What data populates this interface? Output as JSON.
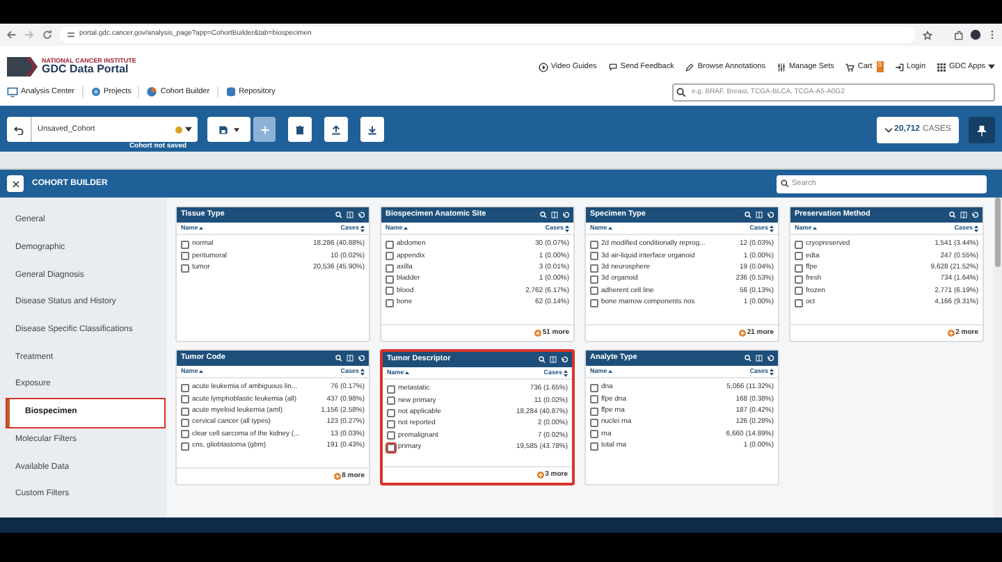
{
  "browser": {
    "url": "portal.gdc.cancer.gov/analysis_page?app=CohortBuilder&tab=biospecimen"
  },
  "header": {
    "org": "NATIONAL CANCER INSTITUTE",
    "title": "GDC Data Portal",
    "links": [
      {
        "kind": "video",
        "label": "Video Guides"
      },
      {
        "kind": "feedback",
        "label": "Send Feedback"
      },
      {
        "kind": "annotations",
        "label": "Browse Annotations"
      },
      {
        "kind": "sets",
        "label": "Manage Sets"
      },
      {
        "kind": "cart",
        "label": "Cart",
        "badge": "0"
      },
      {
        "kind": "login",
        "label": "Login"
      },
      {
        "kind": "apps",
        "label": "GDC Apps"
      }
    ],
    "nav": [
      {
        "kind": "analysis",
        "label": "Analysis Center"
      },
      {
        "kind": "projects",
        "label": "Projects"
      },
      {
        "kind": "cohort",
        "label": "Cohort Builder"
      },
      {
        "kind": "repository",
        "label": "Repository"
      }
    ],
    "search": {
      "placeholder": "e.g. BRAF, Breast, TCGA-BLCA, TCGA-A5-A0G2"
    }
  },
  "cohort_bar": {
    "name": "Unsaved_Cohort",
    "status": "Cohort not saved",
    "cases_count": "20,712",
    "cases_label": "CASES"
  },
  "cohort_builder": {
    "title": "COHORT BUILDER",
    "search": {
      "placeholder": "Search"
    },
    "sidebar": [
      {
        "label": "General",
        "selected": false,
        "highlighted": false
      },
      {
        "label": "Demographic",
        "selected": false,
        "highlighted": false
      },
      {
        "label": "General Diagnosis",
        "selected": false,
        "highlighted": false
      },
      {
        "label": "Disease Status and History",
        "selected": false,
        "highlighted": false
      },
      {
        "label": "Disease Specific Classifications",
        "selected": false,
        "highlighted": false
      },
      {
        "label": "Treatment",
        "selected": false,
        "highlighted": false
      },
      {
        "label": "Exposure",
        "selected": false,
        "highlighted": false
      },
      {
        "label": "Biospecimen",
        "selected": true,
        "highlighted": true
      },
      {
        "label": "Molecular Filters",
        "selected": false,
        "highlighted": false
      },
      {
        "label": "Available Data",
        "selected": false,
        "highlighted": false
      },
      {
        "label": "Custom Filters",
        "selected": false,
        "highlighted": false
      }
    ],
    "cards": [
      {
        "title": "Tissue Type",
        "name_header": "Name",
        "cases_header": "Cases",
        "highlighted": false,
        "rows": [
          {
            "name": "normal",
            "cases": "18,286 (40.88%)",
            "checked": false,
            "highlighted": false
          },
          {
            "name": "peritumoral",
            "cases": "10 (0.02%)",
            "checked": false,
            "highlighted": false
          },
          {
            "name": "tumor",
            "cases": "20,536 (45.90%)",
            "checked": false,
            "highlighted": false
          }
        ]
      },
      {
        "title": "Biospecimen Anatomic Site",
        "name_header": "Name",
        "cases_header": "Cases",
        "highlighted": false,
        "more": "51 more",
        "rows": [
          {
            "name": "abdomen",
            "cases": "30 (0.07%)",
            "checked": false,
            "highlighted": false
          },
          {
            "name": "appendix",
            "cases": "1 (0.00%)",
            "checked": false,
            "highlighted": false
          },
          {
            "name": "axilla",
            "cases": "3 (0.01%)",
            "checked": false,
            "highlighted": false
          },
          {
            "name": "bladder",
            "cases": "1 (0.00%)",
            "checked": false,
            "highlighted": false
          },
          {
            "name": "blood",
            "cases": "2,762 (6.17%)",
            "checked": false,
            "highlighted": false
          },
          {
            "name": "bone",
            "cases": "62 (0.14%)",
            "checked": false,
            "highlighted": false
          }
        ]
      },
      {
        "title": "Specimen Type",
        "name_header": "Name",
        "cases_header": "Cases",
        "highlighted": false,
        "more": "21 more",
        "rows": [
          {
            "name": "2d modified conditionally reprog...",
            "cases": "12 (0.03%)",
            "checked": false,
            "highlighted": false
          },
          {
            "name": "3d air-liquid interface organoid",
            "cases": "1 (0.00%)",
            "checked": false,
            "highlighted": false
          },
          {
            "name": "3d neurosphere",
            "cases": "19 (0.04%)",
            "checked": false,
            "highlighted": false
          },
          {
            "name": "3d organoid",
            "cases": "236 (0.53%)",
            "checked": false,
            "highlighted": false
          },
          {
            "name": "adherent cell line",
            "cases": "56 (0.13%)",
            "checked": false,
            "highlighted": false
          },
          {
            "name": "bone marrow components nos",
            "cases": "1 (0.00%)",
            "checked": false,
            "highlighted": false
          }
        ]
      },
      {
        "title": "Preservation Method",
        "name_header": "Name",
        "cases_header": "Cases",
        "highlighted": false,
        "more": "2 more",
        "rows": [
          {
            "name": "cryopreserved",
            "cases": "1,541 (3.44%)",
            "checked": false,
            "highlighted": false
          },
          {
            "name": "edta",
            "cases": "247 (0.55%)",
            "checked": false,
            "highlighted": false
          },
          {
            "name": "ffpe",
            "cases": "9,628 (21.52%)",
            "checked": false,
            "highlighted": false
          },
          {
            "name": "fresh",
            "cases": "734 (1.64%)",
            "checked": false,
            "highlighted": false
          },
          {
            "name": "frozen",
            "cases": "2,771 (6.19%)",
            "checked": false,
            "highlighted": false
          },
          {
            "name": "oct",
            "cases": "4,166 (9.31%)",
            "checked": false,
            "highlighted": false
          }
        ]
      },
      {
        "title": "Tumor Code",
        "name_header": "Name",
        "cases_header": "Cases",
        "highlighted": false,
        "more": "8 more",
        "rows": [
          {
            "name": "acute leukemia of ambiguous lin...",
            "cases": "76 (0.17%)",
            "checked": false,
            "highlighted": false
          },
          {
            "name": "acute lymphoblastic leukemia (all)",
            "cases": "437 (0.98%)",
            "checked": false,
            "highlighted": false
          },
          {
            "name": "acute myeloid leukemia (aml)",
            "cases": "1,156 (2.58%)",
            "checked": false,
            "highlighted": false
          },
          {
            "name": "cervical cancer (all types)",
            "cases": "123 (0.27%)",
            "checked": false,
            "highlighted": false
          },
          {
            "name": "clear cell sarcoma of the kidney (...",
            "cases": "13 (0.03%)",
            "checked": false,
            "highlighted": false
          },
          {
            "name": "cns, glioblastoma (gbm)",
            "cases": "191 (0.43%)",
            "checked": false,
            "highlighted": false
          }
        ]
      },
      {
        "title": "Tumor Descriptor",
        "name_header": "Name",
        "cases_header": "Cases",
        "highlighted": true,
        "more": "3 more",
        "rows": [
          {
            "name": "metastatic",
            "cases": "736 (1.65%)",
            "checked": false,
            "highlighted": false
          },
          {
            "name": "new primary",
            "cases": "11 (0.02%)",
            "checked": false,
            "highlighted": false
          },
          {
            "name": "not applicable",
            "cases": "18,284 (40.87%)",
            "checked": false,
            "highlighted": false
          },
          {
            "name": "not reported",
            "cases": "2 (0.00%)",
            "checked": false,
            "highlighted": false
          },
          {
            "name": "premalignant",
            "cases": "7 (0.02%)",
            "checked": false,
            "highlighted": false
          },
          {
            "name": "primary",
            "cases": "19,585 (43.78%)",
            "checked": false,
            "highlighted": true
          }
        ]
      },
      {
        "title": "Analyte Type",
        "name_header": "Name",
        "cases_header": "Cases",
        "highlighted": false,
        "rows": [
          {
            "name": "dna",
            "cases": "5,066 (11.32%)",
            "checked": false,
            "highlighted": false
          },
          {
            "name": "ffpe dna",
            "cases": "168 (0.38%)",
            "checked": false,
            "highlighted": false
          },
          {
            "name": "ffpe rna",
            "cases": "187 (0.42%)",
            "checked": false,
            "highlighted": false
          },
          {
            "name": "nuclei rna",
            "cases": "126 (0.28%)",
            "checked": false,
            "highlighted": false
          },
          {
            "name": "rna",
            "cases": "6,660 (14.89%)",
            "checked": false,
            "highlighted": false
          },
          {
            "name": "total rna",
            "cases": "1 (0.00%)",
            "checked": false,
            "highlighted": false
          }
        ]
      }
    ]
  }
}
